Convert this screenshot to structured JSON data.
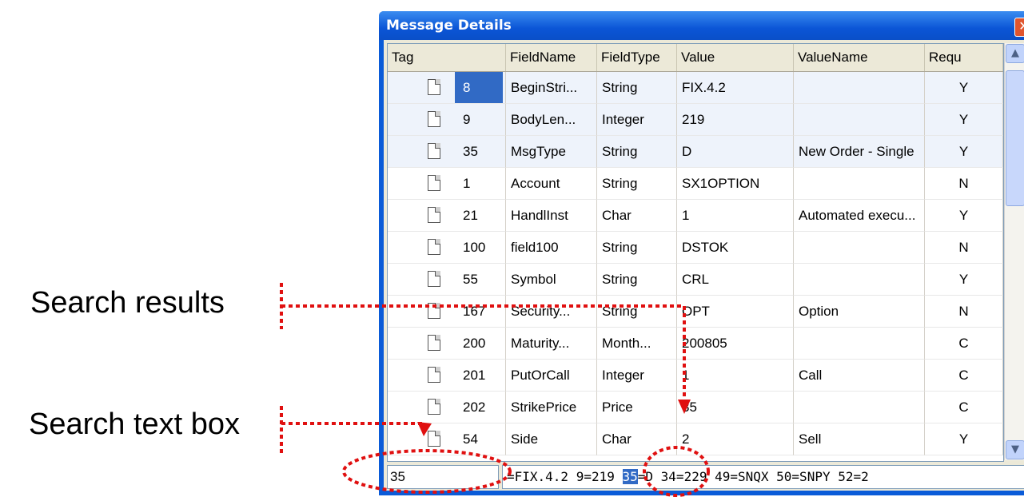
{
  "annotations": {
    "search_results_label": "Search results",
    "search_text_box_label": "Search text box",
    "color": "#e01010"
  },
  "window": {
    "title": "Message Details",
    "close_glyph": "✕"
  },
  "columns": [
    "Tag",
    "FieldName",
    "FieldType",
    "Value",
    "ValueName",
    "Requ"
  ],
  "rows": [
    {
      "tag": "8",
      "fieldname": "BeginStri...",
      "fieldtype": "String",
      "value": "FIX.4.2",
      "valuename": "",
      "required": "Y"
    },
    {
      "tag": "9",
      "fieldname": "BodyLen...",
      "fieldtype": "Integer",
      "value": "219",
      "valuename": "",
      "required": "Y"
    },
    {
      "tag": "35",
      "fieldname": "MsgType",
      "fieldtype": "String",
      "value": "D",
      "valuename": "New Order - Single",
      "required": "Y"
    },
    {
      "tag": "1",
      "fieldname": "Account",
      "fieldtype": "String",
      "value": "SX1OPTION",
      "valuename": "",
      "required": "N"
    },
    {
      "tag": "21",
      "fieldname": "HandlInst",
      "fieldtype": "Char",
      "value": "1",
      "valuename": "Automated execu...",
      "required": "Y"
    },
    {
      "tag": "100",
      "fieldname": "field100",
      "fieldtype": "String",
      "value": "DSTOK",
      "valuename": "",
      "required": "N"
    },
    {
      "tag": "55",
      "fieldname": "Symbol",
      "fieldtype": "String",
      "value": "CRL",
      "valuename": "",
      "required": "Y"
    },
    {
      "tag": "167",
      "fieldname": "Security...",
      "fieldtype": "String",
      "value": "OPT",
      "valuename": "Option",
      "required": "N"
    },
    {
      "tag": "200",
      "fieldname": "Maturity...",
      "fieldtype": "Month...",
      "value": "200805",
      "valuename": "",
      "required": "C"
    },
    {
      "tag": "201",
      "fieldname": "PutOrCall",
      "fieldtype": "Integer",
      "value": "1",
      "valuename": "Call",
      "required": "C"
    },
    {
      "tag": "202",
      "fieldname": "StrikePrice",
      "fieldtype": "Price",
      "value": "35",
      "valuename": "",
      "required": "C"
    },
    {
      "tag": "54",
      "fieldname": "Side",
      "fieldtype": "Char",
      "value": "2",
      "valuename": "Sell",
      "required": "Y"
    }
  ],
  "selected_rows": [
    0,
    1,
    2
  ],
  "highlighted_row": 0,
  "search": {
    "value": "35"
  },
  "raw_message": {
    "before": "=FIX.4.2 9=219 ",
    "match": "35",
    "after": "=D 34=229 49=SNQX 50=SNPY 52=2"
  },
  "icons": {
    "row_icon": "document-icon",
    "scroll_up": "chevron-up-icon",
    "scroll_down": "chevron-down-icon"
  }
}
